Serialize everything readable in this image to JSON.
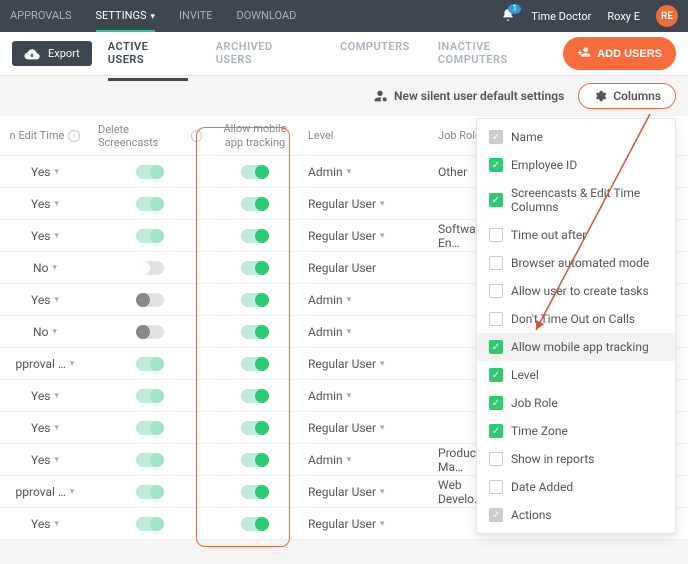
{
  "topbar": {
    "nav": {
      "approvals": "APPROVALS",
      "settings": "SETTINGS",
      "invite": "INVITE",
      "download": "DOWNLOAD"
    },
    "notif_count": "1",
    "company": "Time Doctor",
    "user": "Roxy E",
    "avatar": "RE"
  },
  "subbar": {
    "export": "Export",
    "tabs": {
      "active": "ACTIVE USERS",
      "archived": "ARCHIVED USERS",
      "computers": "COMPUTERS",
      "inactive": "INACTIVE COMPUTERS"
    },
    "add": "ADD USERS"
  },
  "settingsRow": {
    "silent": "New silent user default settings",
    "columns": "Columns"
  },
  "headers": {
    "edit": "n Edit Time",
    "del": "Delete Screencasts",
    "mob": "Allow mobile app tracking",
    "lvl": "Level",
    "job": "Job Role"
  },
  "rows": [
    {
      "edit": "Yes",
      "del": "on-light",
      "mob": "on",
      "lvl": "Admin",
      "dd": true,
      "job": "Other"
    },
    {
      "edit": "Yes",
      "del": "on-light",
      "mob": "on",
      "lvl": "Regular User",
      "dd": true,
      "job": ""
    },
    {
      "edit": "Yes",
      "del": "on-light",
      "mob": "on",
      "lvl": "Regular User",
      "dd": true,
      "job": "Software En…"
    },
    {
      "edit": "No",
      "del": "off",
      "mob": "on",
      "lvl": "Regular User",
      "dd": false,
      "job": ""
    },
    {
      "edit": "Yes",
      "del": "off-dark",
      "mob": "on",
      "lvl": "Admin",
      "dd": true,
      "job": ""
    },
    {
      "edit": "No",
      "del": "off-dark",
      "mob": "on",
      "lvl": "Admin",
      "dd": true,
      "job": ""
    },
    {
      "edit": "pproval …",
      "del": "on-light",
      "mob": "on",
      "lvl": "Regular User",
      "dd": true,
      "job": ""
    },
    {
      "edit": "Yes",
      "del": "on-light",
      "mob": "on",
      "lvl": "Admin",
      "dd": true,
      "job": ""
    },
    {
      "edit": "Yes",
      "del": "on-light",
      "mob": "on",
      "lvl": "Regular User",
      "dd": true,
      "job": ""
    },
    {
      "edit": "Yes",
      "del": "on-light",
      "mob": "on",
      "lvl": "Admin",
      "dd": true,
      "job": "Product Ma…"
    },
    {
      "edit": "pproval …",
      "del": "on-light",
      "mob": "on",
      "lvl": "Regular User",
      "dd": true,
      "job": "Web Develo…"
    },
    {
      "edit": "Yes",
      "del": "on-light",
      "mob": "on",
      "lvl": "Regular User",
      "dd": true,
      "job": ""
    }
  ],
  "dropdown": [
    {
      "label": "Name",
      "state": "locked"
    },
    {
      "label": "Employee ID",
      "state": "checked"
    },
    {
      "label": "Screencasts & Edit Time Columns",
      "state": "checked"
    },
    {
      "label": "Time out after",
      "state": "unchecked"
    },
    {
      "label": "Browser automated mode",
      "state": "unchecked"
    },
    {
      "label": "Allow user to create tasks",
      "state": "unchecked"
    },
    {
      "label": "Don't Time Out on Calls",
      "state": "unchecked"
    },
    {
      "label": "Allow mobile app tracking",
      "state": "checked",
      "hl": true
    },
    {
      "label": "Level",
      "state": "checked"
    },
    {
      "label": "Job Role",
      "state": "checked"
    },
    {
      "label": "Time Zone",
      "state": "checked"
    },
    {
      "label": "Show in reports",
      "state": "unchecked"
    },
    {
      "label": "Date Added",
      "state": "unchecked"
    },
    {
      "label": "Actions",
      "state": "locked"
    }
  ]
}
